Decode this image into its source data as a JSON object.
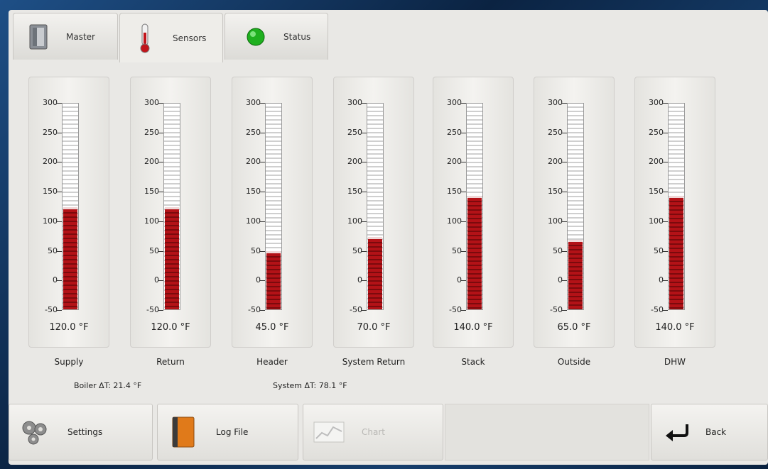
{
  "tabs": [
    {
      "label": "Master",
      "icon": "server-icon"
    },
    {
      "label": "Sensors",
      "icon": "thermometer-icon"
    },
    {
      "label": "Status",
      "icon": "green-status-light-icon"
    }
  ],
  "active_tab": "Sensors",
  "scale_labels": [
    "300",
    "250",
    "200",
    "150",
    "100",
    "50",
    "0",
    "-50"
  ],
  "scale_range": [
    -50,
    300
  ],
  "sensors": [
    {
      "name": "Supply",
      "value": 120.0,
      "reading": "120.0 °F"
    },
    {
      "name": "Return",
      "value": 120.0,
      "reading": "120.0 °F"
    },
    {
      "name": "Header",
      "value": 45.0,
      "reading": "45.0 °F"
    },
    {
      "name": "System Return",
      "value": 70.0,
      "reading": "70.0 °F"
    },
    {
      "name": "Stack",
      "value": 140.0,
      "reading": "140.0 °F"
    },
    {
      "name": "Outside",
      "value": 65.0,
      "reading": "65.0 °F"
    },
    {
      "name": "DHW",
      "value": 140.0,
      "reading": "140.0 °F"
    }
  ],
  "deltas": {
    "boiler": "Boiler ΔT:  21.4 °F",
    "system": "System ΔT:  78.1 °F"
  },
  "bottom_bar": {
    "settings": "Settings",
    "log_file": "Log File",
    "chart": "Chart",
    "back": "Back"
  },
  "colors": {
    "fill_red": "#b31217",
    "status_green": "#1fb01f",
    "log_orange": "#e07a1a"
  }
}
